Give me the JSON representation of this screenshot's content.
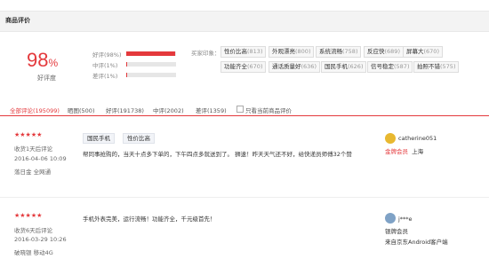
{
  "section_title": "商品评价",
  "summary": {
    "score": "98",
    "score_unit": "%",
    "score_label": "好评度",
    "rates": [
      {
        "label": "好评(98%)",
        "fraction": 0.98
      },
      {
        "label": "中评(1%)",
        "fraction": 0.01
      },
      {
        "label": "差评(1%)",
        "fraction": 0.01
      }
    ]
  },
  "impressions": {
    "label": "买家印象：",
    "tags": [
      {
        "name": "性价比高",
        "count": "(813)"
      },
      {
        "name": "外观漂亮",
        "count": "(800)"
      },
      {
        "name": "系统流畅",
        "count": "(758)"
      },
      {
        "name": "反应快",
        "count": "(689)"
      },
      {
        "name": "屏幕大",
        "count": "(670)"
      },
      {
        "name": "功能齐全",
        "count": "(670)"
      },
      {
        "name": "通话质量好",
        "count": "(636)"
      },
      {
        "name": "国民手机",
        "count": "(626)"
      },
      {
        "name": "信号稳定",
        "count": "(587)"
      },
      {
        "name": "拍照不错",
        "count": "(575)"
      }
    ]
  },
  "filters": {
    "items": [
      "全部评论(195099)",
      "晒图(500)",
      "好评(191738)",
      "中评(2002)",
      "差评(1359)"
    ],
    "only_current": "只看当前商品评价"
  },
  "reviews": [
    {
      "stars": "★★★★★",
      "received": "收货1天后评论",
      "date": "2016-04-06 10:09",
      "spec": "落日金  全网通",
      "tags": [
        "国民手机",
        "性价比高"
      ],
      "content": "帮同事抢购的，当天十点多下单的，下午四点多就送到了。 狮速！昨天天气还不好，给快递员师傅32个赞",
      "username": "catherine051",
      "level": "金牌会员",
      "location": "上海",
      "level_color": "#e4393c",
      "avatar_color": "#e8b830"
    },
    {
      "stars": "★★★★★",
      "received": "收货6天后评论",
      "date": "2016-03-29 10:26",
      "spec": "破晓银  移动4G",
      "tags": [],
      "content": "手机外表完美，运行流畅！功能齐全，千元级首先！",
      "username": "j***e",
      "level": "银牌会员",
      "location": "来自京东Android客户端",
      "level_color": "#333333",
      "avatar_color": "#7fa2c6"
    }
  ],
  "colors": {
    "accent": "#e4393c"
  }
}
